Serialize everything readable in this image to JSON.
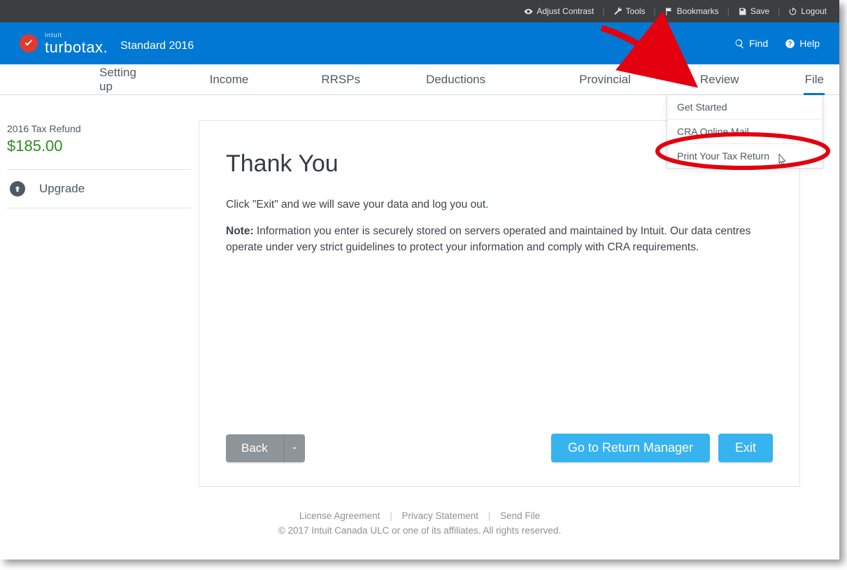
{
  "topbar": {
    "contrast": "Adjust Contrast",
    "tools": "Tools",
    "bookmarks": "Bookmarks",
    "save": "Save",
    "logout": "Logout"
  },
  "brand": {
    "small": "intuit",
    "main": "turbotax",
    "version": "Standard 2016",
    "find": "Find",
    "help": "Help"
  },
  "tabs": {
    "setting": "Setting up",
    "income": "Income",
    "rrsps": "RRSPs",
    "deductions": "Deductions",
    "provincial": "Provincial",
    "review": "Review",
    "file": "File"
  },
  "dropdown": {
    "items": [
      "Get Started",
      "CRA Online Mail",
      "Print Your Tax Return"
    ]
  },
  "sidebar": {
    "refund_label": "2016 Tax Refund",
    "refund_amount": "$185.00",
    "upgrade": "Upgrade"
  },
  "main": {
    "title": "Thank You",
    "line1": "Click \"Exit\" and we will save your data and log you out.",
    "note_label": "Note:",
    "note_body": " Information you enter is securely stored on servers operated and maintained by Intuit. Our data centres operate under very strict guidelines to protect your information and comply with CRA requirements.",
    "back": "Back",
    "goto_manager": "Go to Return Manager",
    "exit": "Exit"
  },
  "footer": {
    "license": "License Agreement",
    "privacy": "Privacy Statement",
    "sendfile": "Send File",
    "copyright": "© 2017 Intuit Canada ULC or one of its affiliates. All rights reserved."
  }
}
